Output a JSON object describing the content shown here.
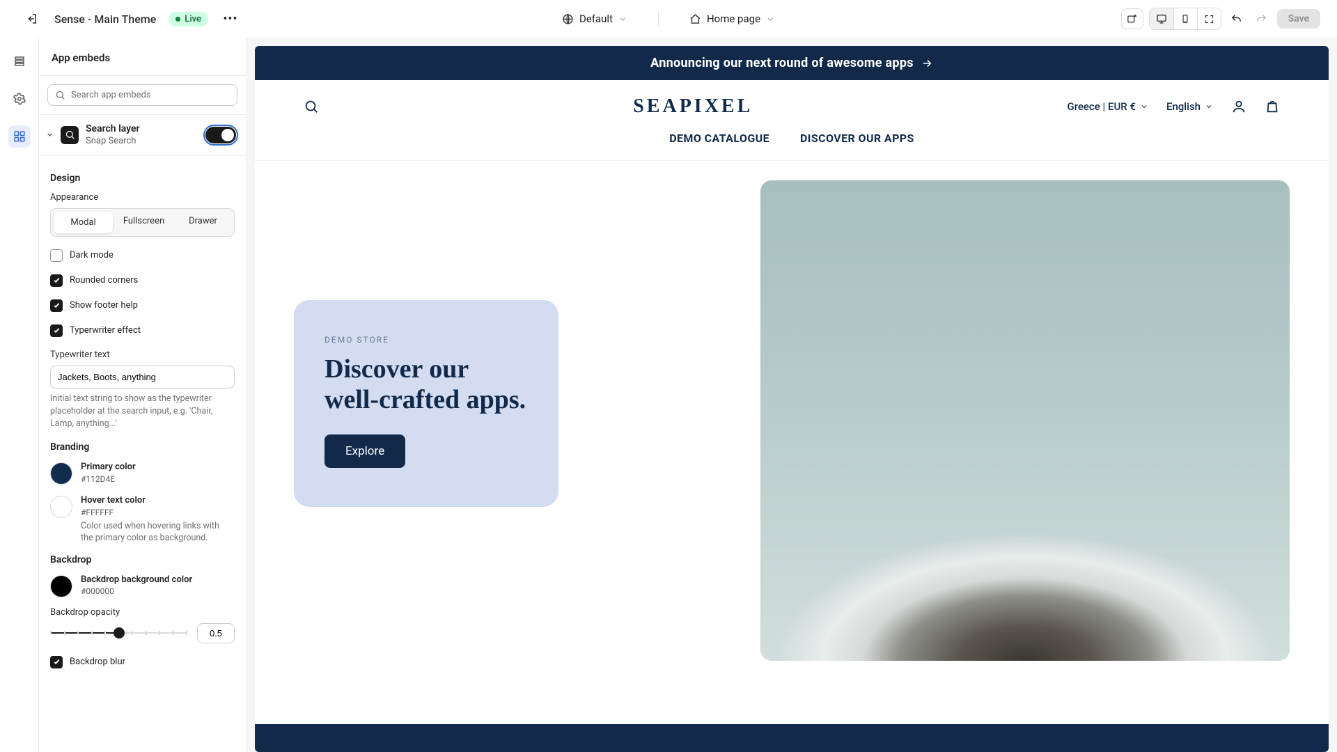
{
  "topbar": {
    "theme_name": "Sense - Main Theme",
    "live_badge": "Live",
    "default_selector": "Default",
    "page_selector": "Home page",
    "save_label": "Save"
  },
  "panel": {
    "title": "App embeds",
    "search_placeholder": "Search app embeds",
    "embed": {
      "title": "Search layer",
      "subtitle": "Snap Search"
    },
    "sections": {
      "design": "Design",
      "branding": "Branding",
      "backdrop": "Backdrop"
    },
    "appearance": {
      "label": "Appearance",
      "options": [
        "Modal",
        "Fullscreen",
        "Drawer"
      ]
    },
    "checks": {
      "dark_mode": "Dark mode",
      "rounded": "Rounded corners",
      "footer_help": "Show footer help",
      "typewriter": "Typerwriter effect",
      "backdrop_blur": "Backdrop blur"
    },
    "typewriter": {
      "label": "Typewriter text",
      "value": "Jackets, Boots, anything",
      "help": "Initial text string to show as the typewriter placeholder at the search input, e.g. 'Chair, Lamp, anything...'"
    },
    "colors": {
      "primary": {
        "label": "Primary color",
        "hex": "#112D4E",
        "swatch": "#112D4E"
      },
      "hover": {
        "label": "Hover text color",
        "hex": "#FFFFFF",
        "swatch": "#FFFFFF",
        "desc": "Color used when hovering links with the primary color as background."
      },
      "backdrop": {
        "label": "Backdrop background color",
        "hex": "#000000",
        "swatch": "#000000"
      }
    },
    "opacity": {
      "label": "Backdrop opacity",
      "value": "0.5",
      "pct": 50
    }
  },
  "preview": {
    "announcement": "Announcing our next round of awesome apps",
    "brand": "SEAPIXEL",
    "locale": "Greece | EUR €",
    "language": "English",
    "nav": [
      "DEMO CATALOGUE",
      "DISCOVER OUR APPS"
    ],
    "hero": {
      "eyebrow": "DEMO STORE",
      "title": "Discover our well-crafted apps.",
      "cta": "Explore"
    }
  }
}
